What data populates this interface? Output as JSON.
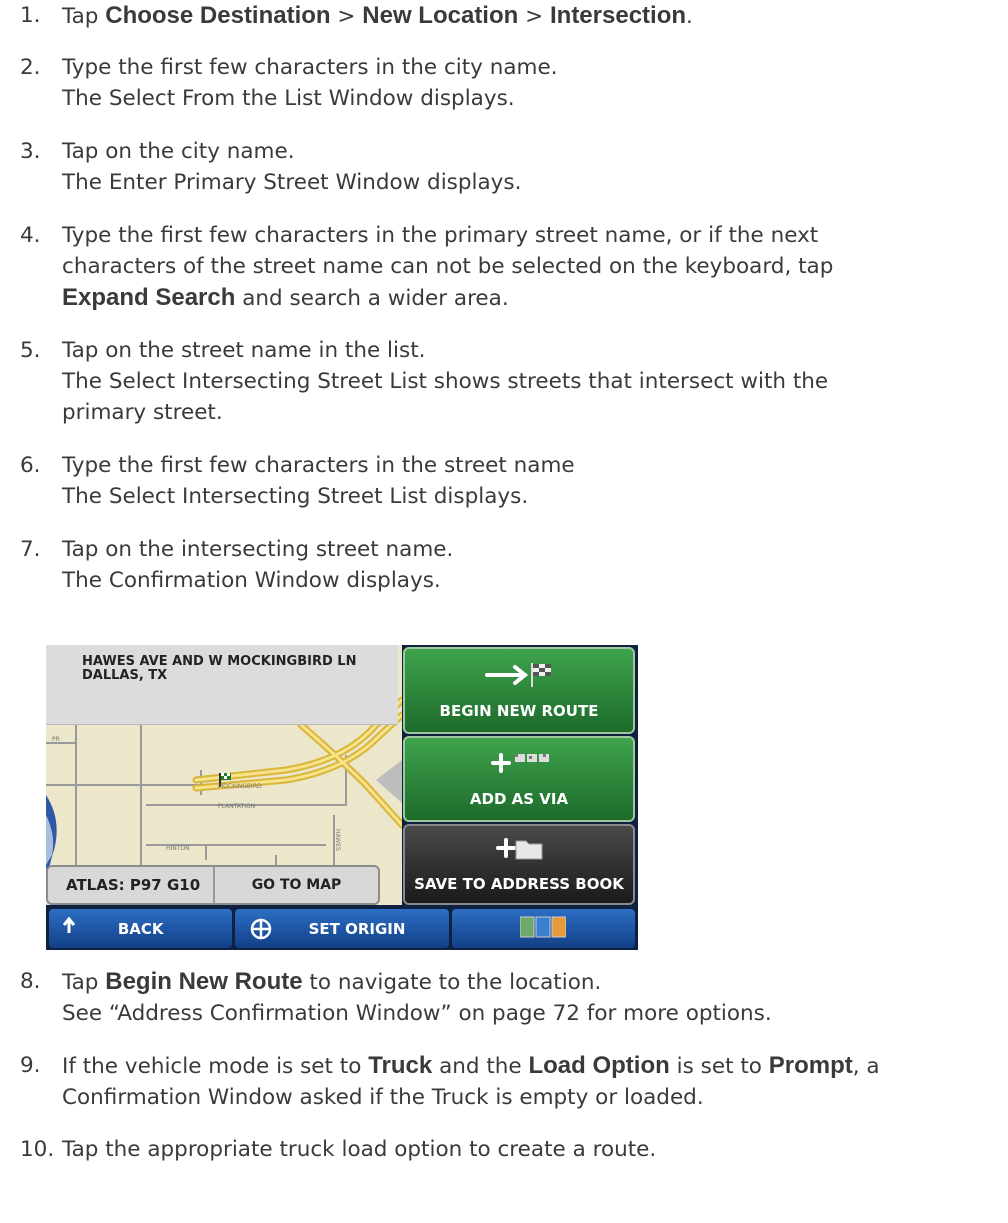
{
  "steps": [
    {
      "num": "1.",
      "pre": "Tap ",
      "k1": "Choose Destination",
      "m1": " > ",
      "k2": "New Location",
      "m2": " > ",
      "k3": "Intersection",
      "post": "."
    },
    {
      "num": "2.",
      "line1": "Type the first few characters in the city name.",
      "line2": "The Select From the List Window displays."
    },
    {
      "num": "3.",
      "line1": "Tap on the city name.",
      "line2": "The Enter Primary Street Window displays."
    },
    {
      "num": "4.",
      "line1": "Type the first few characters in the primary street name, or if the next",
      "line2": "characters of the street name can not be selected on the keyboard, tap",
      "k1": "Expand Search",
      "line3": " and search a wider area."
    },
    {
      "num": "5.",
      "line1": "Tap on the street name in the list.",
      "line2": "The Select Intersecting Street List shows streets that intersect with the",
      "line3": "primary street."
    },
    {
      "num": "6.",
      "line1": "Type the first few characters in the street name",
      "line2": "The Select Intersecting Street List displays."
    },
    {
      "num": "7.",
      "line1": "Tap on the intersecting street name.",
      "line2": "The Confirmation Window displays."
    },
    {
      "num": "8.",
      "pre": "Tap ",
      "k1": "Begin New Route",
      "post": " to navigate to the location.",
      "line2": "See “Address Confirmation Window” on page 72 for more options."
    },
    {
      "num": "9.",
      "pre": "If the vehicle mode is set to ",
      "k1": "Truck",
      "m1": " and the ",
      "k2": "Load Option",
      "m2": " is set to ",
      "k3": "Prompt",
      "post": ", a",
      "line2": "Confirmation Window asked if the Truck is empty or loaded."
    },
    {
      "num": "10.",
      "line1": "Tap the appropriate truck load option to create a route."
    }
  ],
  "device": {
    "address_line1": "HAWES AVE AND W MOCKINGBIRD LN",
    "address_line2": "DALLAS, TX",
    "atlas": "ATLAS: P97 G10",
    "go_to_map": "GO TO MAP",
    "begin_new_route": "BEGIN NEW ROUTE",
    "add_as_via": "ADD AS VIA",
    "save_to_address_book": "SAVE TO ADDRESS BOOK",
    "back": "BACK",
    "set_origin": "SET ORIGIN",
    "map_labels": {
      "mockingbird": "MOCKINGBIRD",
      "plantation": "PLANTATION",
      "hinton": "HINTON",
      "hawes": "HAWES",
      "pr": "PR"
    }
  }
}
